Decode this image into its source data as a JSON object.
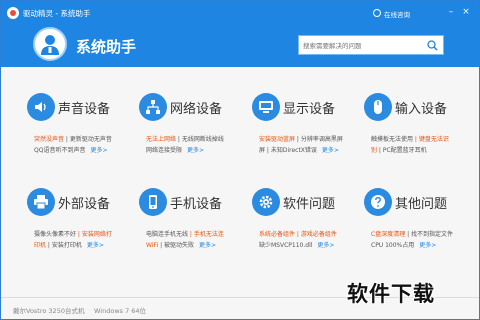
{
  "window": {
    "title": "驱动精灵 - 系统助手",
    "online_label": "在线咨询",
    "minimize_glyph": "–",
    "close_glyph": "×"
  },
  "header": {
    "product_name": "系统助手",
    "search_placeholder": "搜索需要解决的问题",
    "accent": "#1e86e2"
  },
  "categories": [
    {
      "title": "声音设备",
      "icon": "speaker-icon",
      "line1": [
        {
          "t": "突然没声音",
          "hot": true
        },
        {
          "t": " | 更新驱动无声音",
          "hot": false
        }
      ],
      "line2": [
        {
          "t": "QQ语音听不到声音",
          "hot": false
        }
      ],
      "more": "更多>"
    },
    {
      "title": "网络设备",
      "icon": "network-icon",
      "line1": [
        {
          "t": "无法上网络",
          "hot": true
        },
        {
          "t": " | 无线网断线掉线",
          "hot": false
        }
      ],
      "line2": [
        {
          "t": "网络连接受限",
          "hot": false
        }
      ],
      "more": "更多>"
    },
    {
      "title": "显示设备",
      "icon": "monitor-icon",
      "line1": [
        {
          "t": "安装驱动蓝屏",
          "hot": true
        },
        {
          "t": " | 分辨率调高黑屏",
          "hot": false
        }
      ],
      "line2": [
        {
          "t": "屏 | 未知DirectX错误",
          "hot": false
        }
      ],
      "more": "更多>"
    },
    {
      "title": "输入设备",
      "icon": "mouse-icon",
      "line1": [
        {
          "t": "触摸板无法使用",
          "hot": false
        },
        {
          "t": " | 键盘无法识",
          "hot": true
        }
      ],
      "line2": [
        {
          "t": "别",
          "hot": true
        },
        {
          "t": " | PC配置蓝牙耳机",
          "hot": false
        }
      ],
      "more": ""
    },
    {
      "title": "外部设备",
      "icon": "printer-icon",
      "line1": [
        {
          "t": "摄像头像素不好",
          "hot": false
        },
        {
          "t": " | 安装网络打",
          "hot": true
        }
      ],
      "line2": [
        {
          "t": "印机",
          "hot": true
        },
        {
          "t": " | 安装打印机",
          "hot": false
        }
      ],
      "more": "更多>"
    },
    {
      "title": "手机设备",
      "icon": "phone-icon",
      "line1": [
        {
          "t": "电脑连手机无线",
          "hot": false
        },
        {
          "t": " | 手机无法连",
          "hot": true
        }
      ],
      "line2": [
        {
          "t": "WiFi",
          "hot": true
        },
        {
          "t": " | 被驱动失败",
          "hot": false
        }
      ],
      "more": "更多>"
    },
    {
      "title": "软件问题",
      "icon": "gear-icon",
      "line1": [
        {
          "t": "系统必备组件",
          "hot": true
        },
        {
          "t": " | 游戏必备组件",
          "hot": true
        }
      ],
      "line2": [
        {
          "t": "缺少MSVCP110.dll",
          "hot": false
        }
      ],
      "more": "更多>"
    },
    {
      "title": "其他问题",
      "icon": "question-icon",
      "line1": [
        {
          "t": "C盘深度清理",
          "hot": true
        },
        {
          "t": " | 找不到指定文件",
          "hot": false
        }
      ],
      "line2": [
        {
          "t": "CPU 100%占用",
          "hot": false
        }
      ],
      "more": "更多>"
    }
  ],
  "statusbar": {
    "device": "戴尔Vostro 3250台式机",
    "os": "Windows 7 64位"
  },
  "watermark": "软件下载"
}
